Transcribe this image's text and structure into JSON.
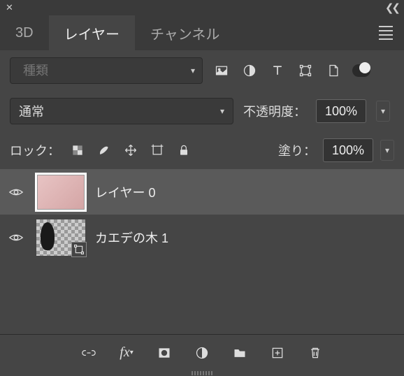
{
  "tabs": [
    "3D",
    "レイヤー",
    "チャンネル"
  ],
  "activeTab": 1,
  "search": {
    "placeholder": "種類"
  },
  "blend": {
    "mode": "通常",
    "opacityLabel": "不透明度：",
    "opacityValue": "100%"
  },
  "lock": {
    "label": "ロック：",
    "fillLabel": "塗り：",
    "fillValue": "100%"
  },
  "layers": [
    {
      "name": "レイヤー 0",
      "selected": true,
      "visible": true,
      "thumb": "woman"
    },
    {
      "name": "カエデの木 1",
      "selected": false,
      "visible": true,
      "thumb": "tree",
      "smartObject": true
    }
  ]
}
